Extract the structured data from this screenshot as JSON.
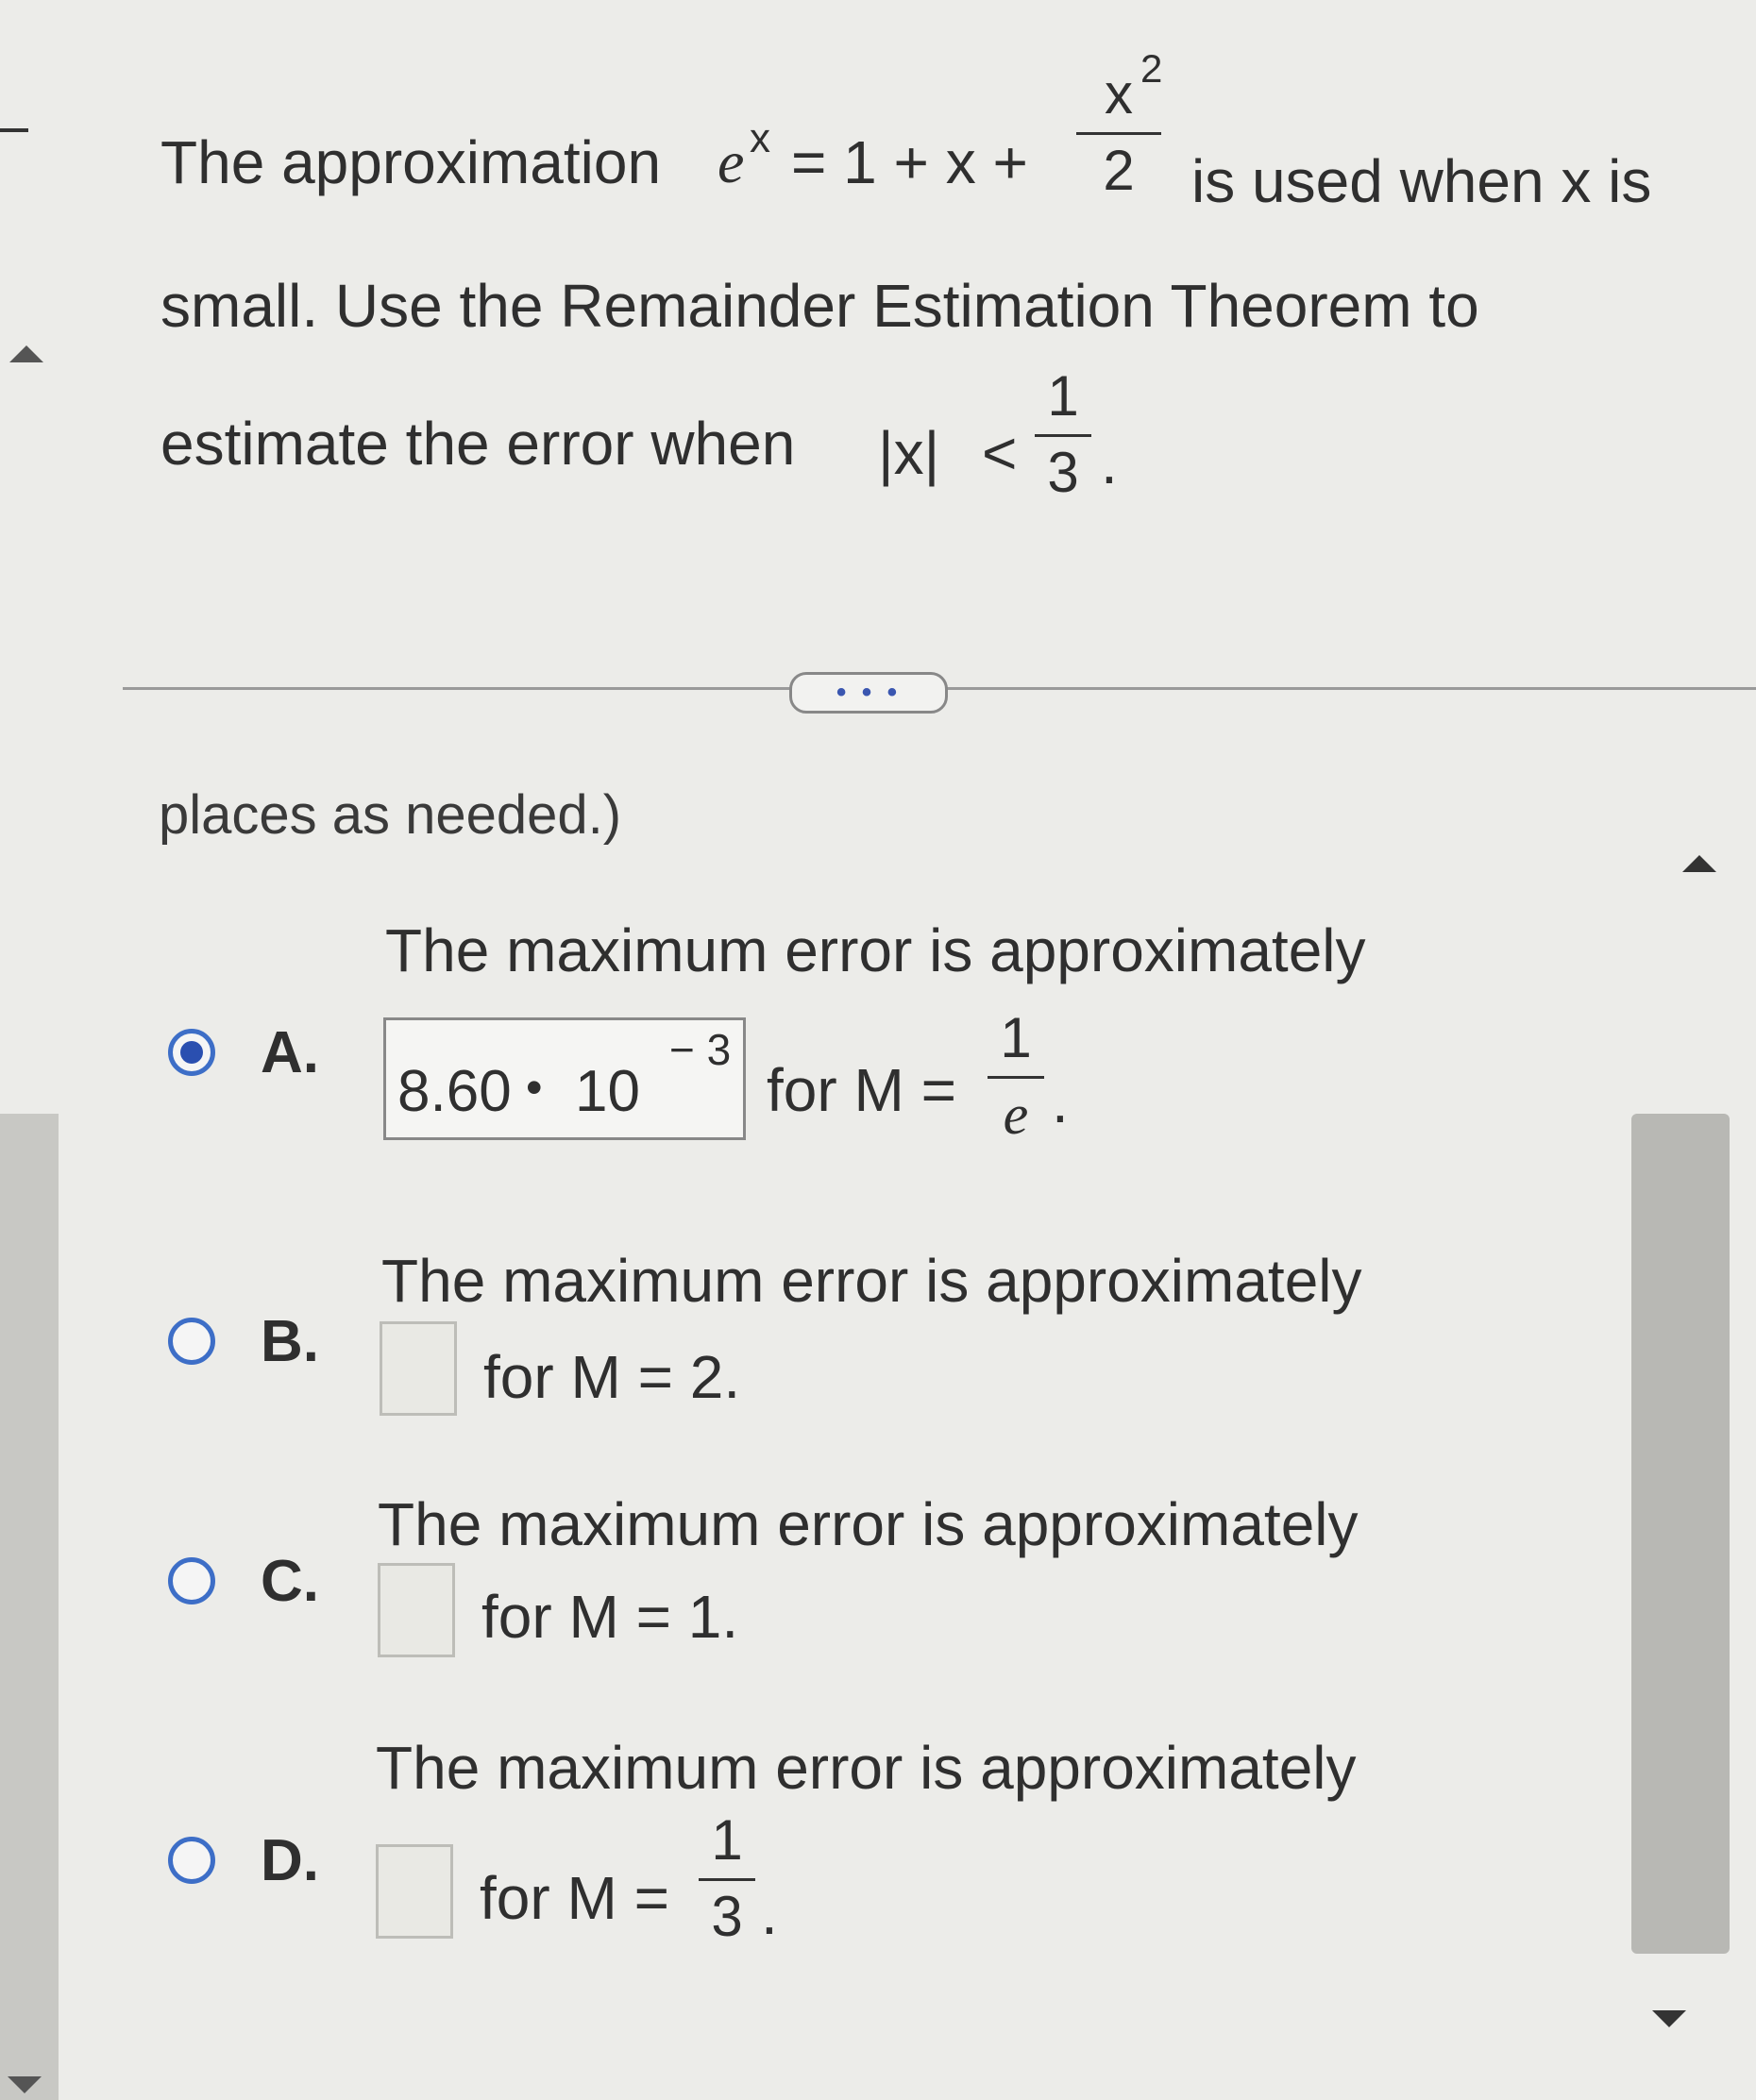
{
  "question": {
    "line1_pre": "The approximation",
    "e_symbol": "e",
    "x_exp": "x",
    "eq_mid": "= 1 + x +",
    "frac_num_base": "x",
    "frac_num_exp": "2",
    "frac_den": "2",
    "line1_post": "is used when x is",
    "line2": "small. Use the Remainder Estimation Theorem to",
    "line3_pre": "estimate the error when",
    "abs_x": "|x|",
    "lt": "<",
    "bound_num": "1",
    "bound_den": "3",
    "period": "."
  },
  "more_button_label": "• • •",
  "instruction_fragment": "places as needed.)",
  "options": [
    {
      "letter": "A.",
      "selected": true,
      "lead": "The maximum error is approximately",
      "answer_mantissa": "8.60",
      "answer_dot": "•",
      "answer_base": "10",
      "answer_exp": "− 3",
      "for_text": "for M =",
      "m_num": "1",
      "m_den": "e",
      "end": "."
    },
    {
      "letter": "B.",
      "selected": false,
      "lead": "The maximum error is approximately",
      "for_text": "for M = 2."
    },
    {
      "letter": "C.",
      "selected": false,
      "lead": "The maximum error is approximately",
      "for_text": "for M = 1."
    },
    {
      "letter": "D.",
      "selected": false,
      "lead": "The maximum error is approximately",
      "for_text": "for M =",
      "m_num": "1",
      "m_den": "3",
      "end": "."
    }
  ],
  "colors": {
    "accent": "#3d6ec7",
    "background": "#ecece9",
    "text": "#2f2f2f"
  }
}
